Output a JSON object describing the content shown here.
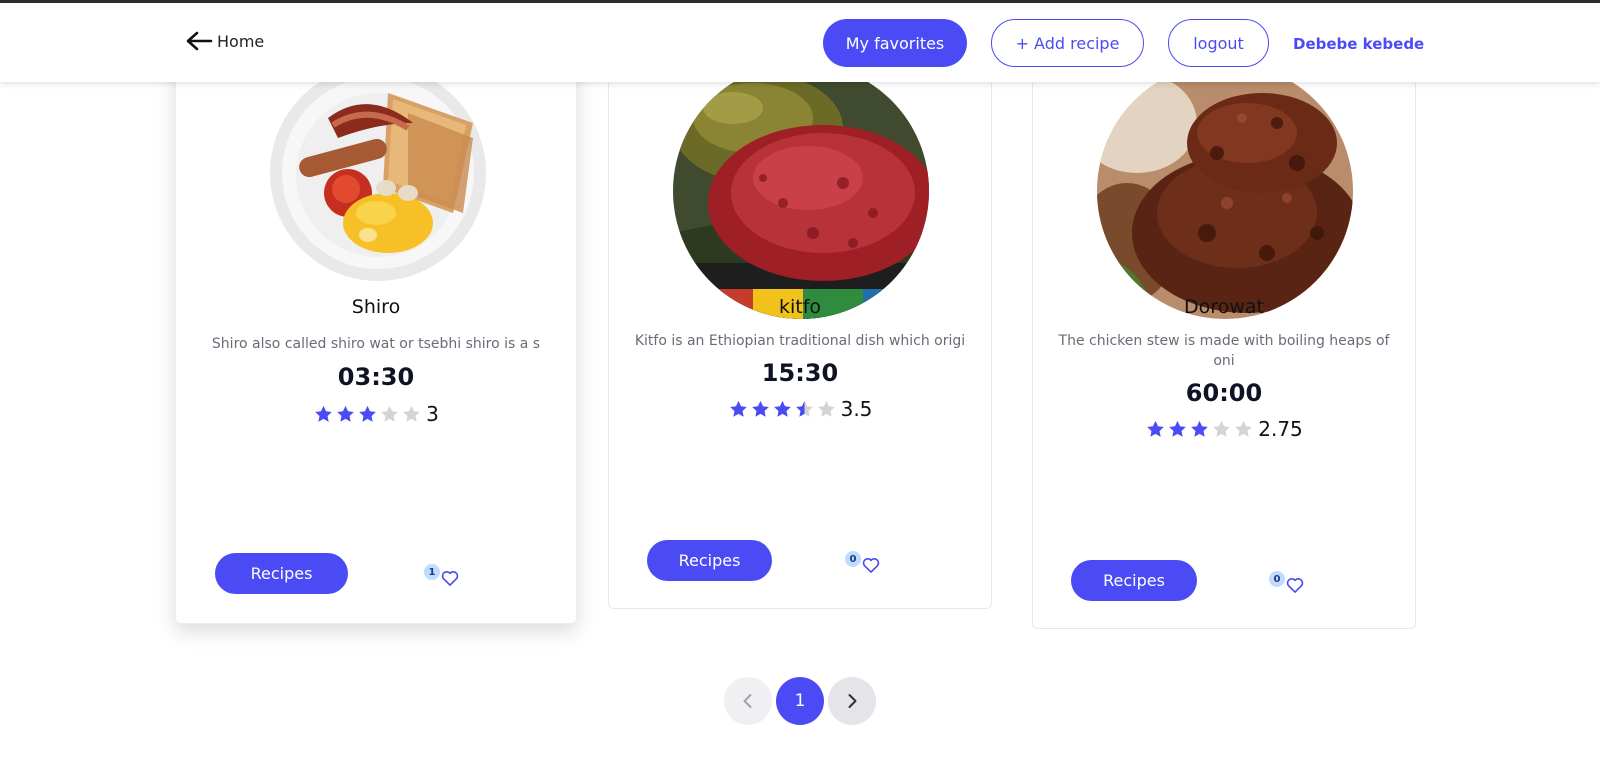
{
  "header": {
    "home_label": "Home",
    "favorites_label": "My favorites",
    "add_recipe_label": "+ Add recipe",
    "logout_label": "logout",
    "user_name": "Debebe kebede"
  },
  "colors": {
    "accent": "#4b4bf5",
    "star_filled": "#4b4bf5",
    "star_empty": "#d4d4d8",
    "badge_bg": "#bfdbfe"
  },
  "recipes": [
    {
      "title": "Shiro",
      "description": "Shiro also called shiro wat or tsebhi shiro is a s",
      "time": "03:30",
      "rating": 3,
      "rating_text": "3",
      "button_label": "Recipes",
      "favorites_count": "1"
    },
    {
      "title": "kitfo",
      "description": "Kitfo is an Ethiopian traditional dish which origi",
      "time": "15:30",
      "rating": 3.5,
      "rating_text": "3.5",
      "button_label": "Recipes",
      "favorites_count": "0"
    },
    {
      "title": "Dorowat",
      "description": "The chicken stew is made with boiling heaps of oni",
      "time": "60:00",
      "rating": 2.75,
      "rating_text": "2.75",
      "button_label": "Recipes",
      "favorites_count": "0"
    }
  ],
  "pagination": {
    "current_page": "1"
  }
}
